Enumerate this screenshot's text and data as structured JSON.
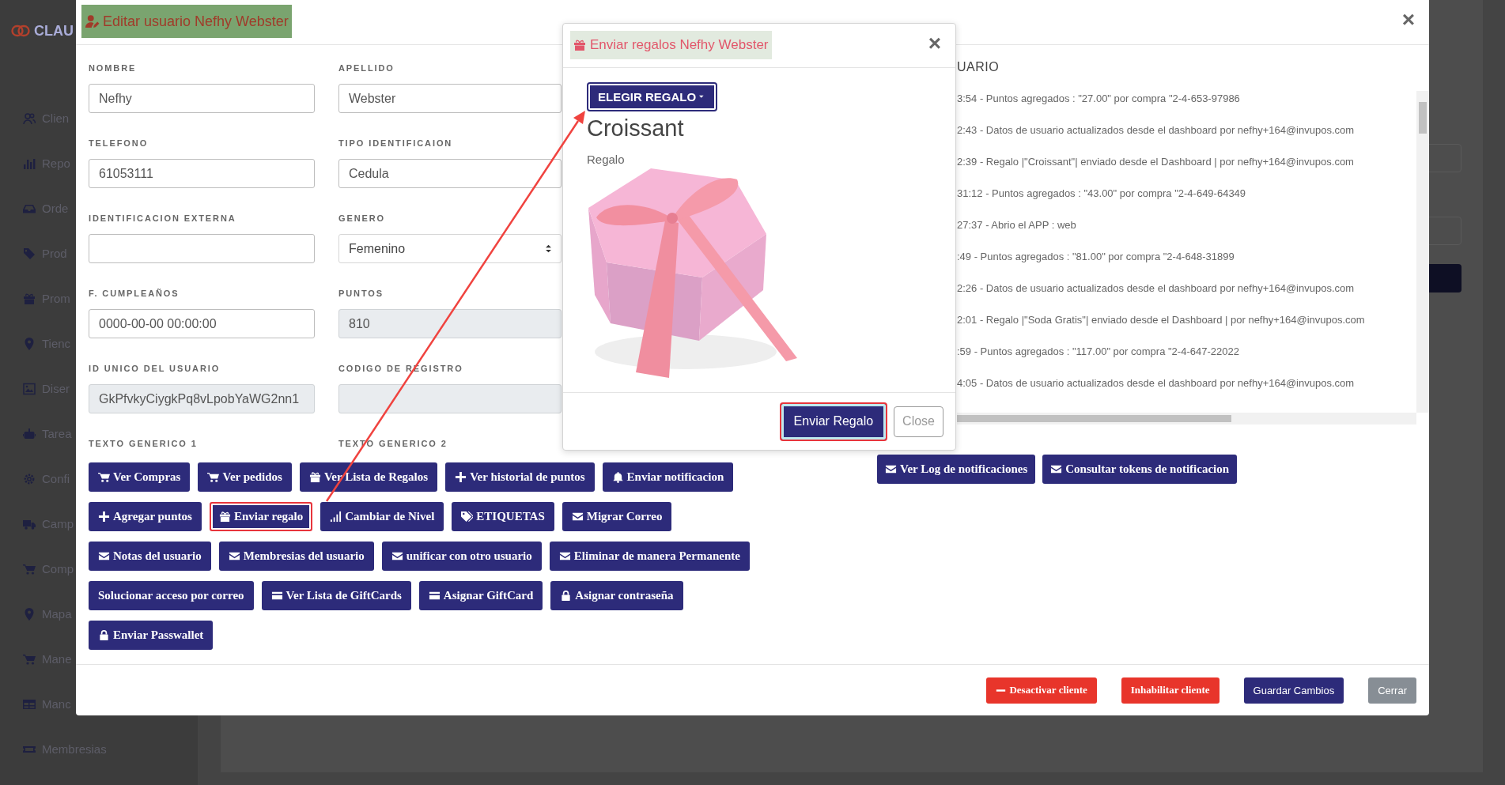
{
  "sidebar": {
    "logo": "CLAU",
    "items": [
      "Clien",
      "Repo",
      "Orde",
      "Prod",
      "Prom",
      "Tienc",
      "Diser",
      "Tarea",
      "Confi",
      "Camp",
      "Comp",
      "Mapa",
      "Mane",
      "Manc",
      "Membresias"
    ]
  },
  "edit_user": {
    "title": "Editar usuario Nefhy Webster",
    "close": "×",
    "fields": [
      {
        "label": "NOMBRE",
        "value": "Nefhy",
        "kind": "text",
        "disabled": false
      },
      {
        "label": "APELLIDO",
        "value": "Webster",
        "kind": "text",
        "disabled": false
      },
      {
        "label": "TELEFONO",
        "value": "61053111",
        "kind": "text",
        "disabled": false
      },
      {
        "label": "TIPO IDENTIFICAION",
        "value": "Cedula",
        "kind": "text",
        "disabled": false
      },
      {
        "label": "IDENTIFICACION EXTERNA",
        "kind": "text",
        "disabled": false
      },
      {
        "label": "GENERO",
        "value": "Femenino",
        "kind": "select",
        "disabled": false
      },
      {
        "label": "F. CUMPLEAÑOS",
        "value": "0000-00-00 00:00:00",
        "kind": "text",
        "disabled": false
      },
      {
        "label": "PUNTOS",
        "value": "810",
        "kind": "text",
        "disabled": true
      },
      {
        "label": "ID UNICO DEL USUARIO",
        "value": "GkPfvkyCiygkPq8vLpobYaWG2nn1",
        "kind": "text",
        "disabled": true
      },
      {
        "label": "CODIGO DE REGISTRO",
        "kind": "text",
        "disabled": true
      }
    ],
    "generic_labels": [
      "TEXTO GENERICO 1",
      "TEXTO GENERICO 2"
    ],
    "action_rows": [
      [
        {
          "label": "Ver Compras",
          "highlighted": false
        },
        {
          "label": "Ver pedidos",
          "highlighted": false
        },
        {
          "label": "Ver Lista de Regalos",
          "highlighted": false
        },
        {
          "label": "Ver historial de puntos",
          "highlighted": false
        },
        {
          "label": "Enviar notificacion",
          "highlighted": false
        }
      ],
      [
        {
          "label": "Agregar puntos",
          "highlighted": false
        },
        {
          "label": "Enviar regalo",
          "highlighted": true
        },
        {
          "label": "Cambiar de Nivel",
          "highlighted": false
        },
        {
          "label": "ETIQUETAS",
          "highlighted": false
        },
        {
          "label": "Migrar Correo",
          "highlighted": false
        }
      ],
      [
        {
          "label": "Notas del usuario",
          "highlighted": false
        },
        {
          "label": "Membresias del usuario",
          "highlighted": false
        },
        {
          "label": "unificar con otro usuario",
          "highlighted": false
        },
        {
          "label": "Eliminar de manera Permanente",
          "highlighted": false
        }
      ],
      [
        {
          "label": "Solucionar acceso por correo",
          "highlighted": false
        },
        {
          "label": "Ver Lista de GiftCards",
          "highlighted": false
        },
        {
          "label": "Asignar GiftCard",
          "highlighted": false
        },
        {
          "label": "Asignar contraseña",
          "highlighted": false
        }
      ],
      [
        {
          "label": "Enviar Passwallet",
          "highlighted": false
        }
      ]
    ],
    "history": {
      "title": "UARIO",
      "entries": [
        "3:54 - Puntos agregados : \"27.00\" por compra \"2-4-653-97986",
        "2:43 - Datos de usuario actualizados desde el dashboard por nefhy+164@invupos.com",
        "2:39 - Regalo |\"Croissant\"| enviado desde el Dashboard | por nefhy+164@invupos.com",
        "31:12 - Puntos agregados : \"43.00\" por compra \"2-4-649-64349",
        "27:37 - Abrio el APP : web",
        ":49 - Puntos agregados : \"81.00\" por compra \"2-4-648-31899",
        "2:26 - Datos de usuario actualizados desde el dashboard por nefhy+164@invupos.com",
        "2:01 - Regalo |\"Soda Gratis\"| enviado desde el Dashboard | por nefhy+164@invupos.com",
        ":59 - Puntos agregados : \"117.00\" por compra \"2-4-647-22022",
        "4:05 - Datos de usuario actualizados desde el dashboard por nefhy+164@invupos.com"
      ]
    },
    "notification_buttons": [
      "Ver Log de notificaciones",
      "Consultar tokens de notificacion"
    ],
    "footer_buttons": [
      {
        "label": "Desactivar cliente",
        "kind": "danger"
      },
      {
        "label": "Inhabilitar cliente",
        "kind": "danger"
      },
      {
        "label": "Guardar Cambios",
        "kind": "primary"
      },
      {
        "label": "Cerrar",
        "kind": "secondary"
      }
    ]
  },
  "gift_modal": {
    "title": "Enviar regalos Nefhy Webster",
    "close": "×",
    "dropdown": {
      "label": "ELEGIR REGALO",
      "highlighted": true
    },
    "gift_name": "Croissant",
    "gift_type": "Regalo",
    "buttons": [
      {
        "label": "Enviar Regalo",
        "kind": "primary",
        "highlighted": true
      },
      {
        "label": "Close",
        "kind": "outline",
        "highlighted": false
      }
    ]
  }
}
